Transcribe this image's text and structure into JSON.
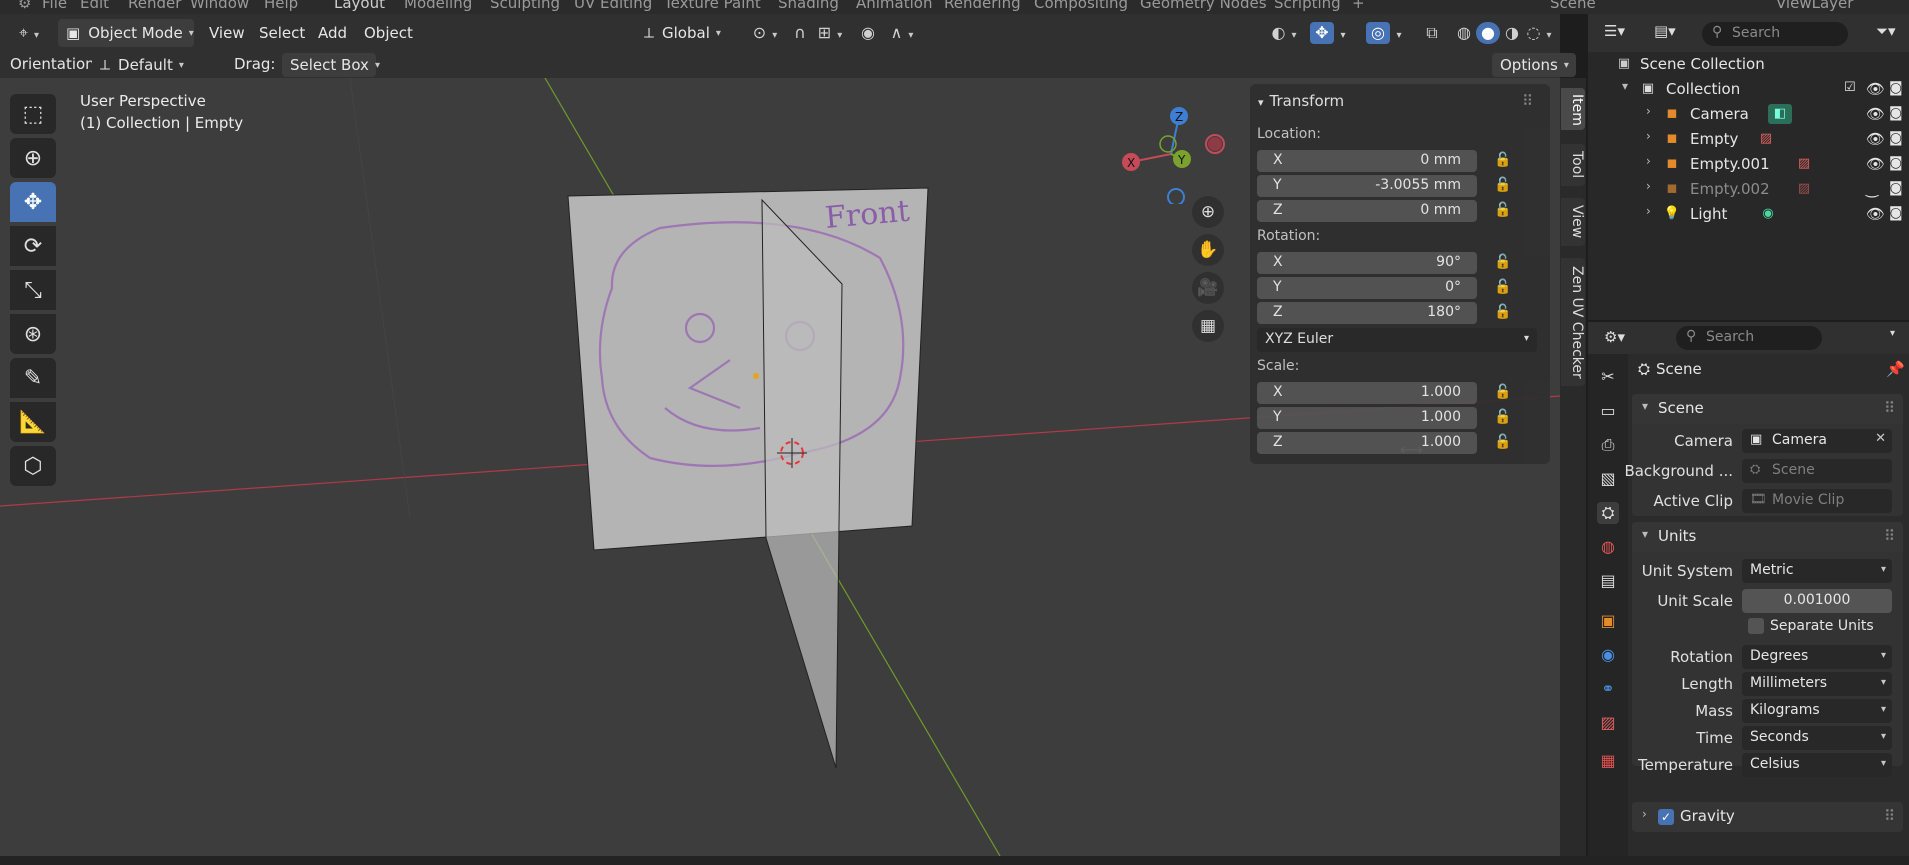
{
  "topbar": {
    "items": [
      "File",
      "Edit",
      "Render",
      "Window",
      "Help"
    ],
    "workspaces": [
      "Layout",
      "Modeling",
      "Sculpting",
      "UV Editing",
      "Texture Paint",
      "Shading",
      "Animation",
      "Rendering",
      "Compositing",
      "Geometry Nodes",
      "Scripting"
    ],
    "scene": "Scene",
    "view_layer": "ViewLayer"
  },
  "header": {
    "mode": "Object Mode",
    "menus": [
      "View",
      "Select",
      "Add",
      "Object"
    ],
    "transform_orientation": "Global",
    "orientation_label": "Orientation:",
    "orientation_value": "Default",
    "drag_label": "Drag:",
    "drag_value": "Select Box",
    "options_label": "Options"
  },
  "viewport": {
    "perspective_label": "User Perspective",
    "context_label": "(1) Collection | Empty",
    "drawing_text": "Front",
    "gizmo_axes": {
      "x": "X",
      "y": "Y",
      "z": "Z"
    }
  },
  "toolbar": {
    "tools": [
      "select-box-icon",
      "cursor-icon",
      "move-icon",
      "rotate-icon",
      "scale-icon",
      "transform-icon",
      "annotate-icon",
      "measure-icon",
      "add-cube-icon"
    ]
  },
  "npanel": {
    "title": "Transform",
    "location_label": "Location:",
    "location": [
      {
        "axis": "X",
        "value": "0 mm"
      },
      {
        "axis": "Y",
        "value": "-3.0055 mm"
      },
      {
        "axis": "Z",
        "value": "0 mm"
      }
    ],
    "rotation_label": "Rotation:",
    "rotation": [
      {
        "axis": "X",
        "value": "90°"
      },
      {
        "axis": "Y",
        "value": "0°"
      },
      {
        "axis": "Z",
        "value": "180°"
      }
    ],
    "rotation_mode": "XYZ Euler",
    "scale_label": "Scale:",
    "scale": [
      {
        "axis": "X",
        "value": "1.000"
      },
      {
        "axis": "Y",
        "value": "1.000"
      },
      {
        "axis": "Z",
        "value": "1.000"
      }
    ],
    "tabs": [
      "Item",
      "Tool",
      "View",
      "Zen UV Checker"
    ]
  },
  "outliner": {
    "search_placeholder": "Search",
    "root": "Scene Collection",
    "collection": "Collection",
    "items": [
      {
        "name": "Camera",
        "icon_color": "#e38a2b",
        "dim": false
      },
      {
        "name": "Empty",
        "icon_color": "#e38a2b",
        "dim": false
      },
      {
        "name": "Empty.001",
        "icon_color": "#e38a2b",
        "dim": false
      },
      {
        "name": "Empty.002",
        "icon_color": "#e38a2b",
        "dim": true
      },
      {
        "name": "Light",
        "icon_color": "#e38a2b",
        "dim": false
      }
    ]
  },
  "properties": {
    "search_placeholder": "Search",
    "context_title": "Scene",
    "scene_panel": {
      "title": "Scene",
      "camera_label": "Camera",
      "camera_value": "Camera",
      "background_label": "Background ...",
      "background_value": "Scene",
      "active_clip_label": "Active Clip",
      "active_clip_value": "Movie Clip"
    },
    "units_panel": {
      "title": "Units",
      "unit_system_label": "Unit System",
      "unit_system_value": "Metric",
      "unit_scale_label": "Unit Scale",
      "unit_scale_value": "0.001000",
      "separate_units_label": "Separate Units",
      "rotation_label": "Rotation",
      "rotation_value": "Degrees",
      "length_label": "Length",
      "length_value": "Millimeters",
      "mass_label": "Mass",
      "mass_value": "Kilograms",
      "time_label": "Time",
      "time_value": "Seconds",
      "temperature_label": "Temperature",
      "temperature_value": "Celsius"
    },
    "gravity_label": "Gravity"
  },
  "colors": {
    "accent": "#4772b3",
    "x_axis": "#c44b57",
    "y_axis": "#7aa22c",
    "z_axis": "#3c7fd4"
  }
}
